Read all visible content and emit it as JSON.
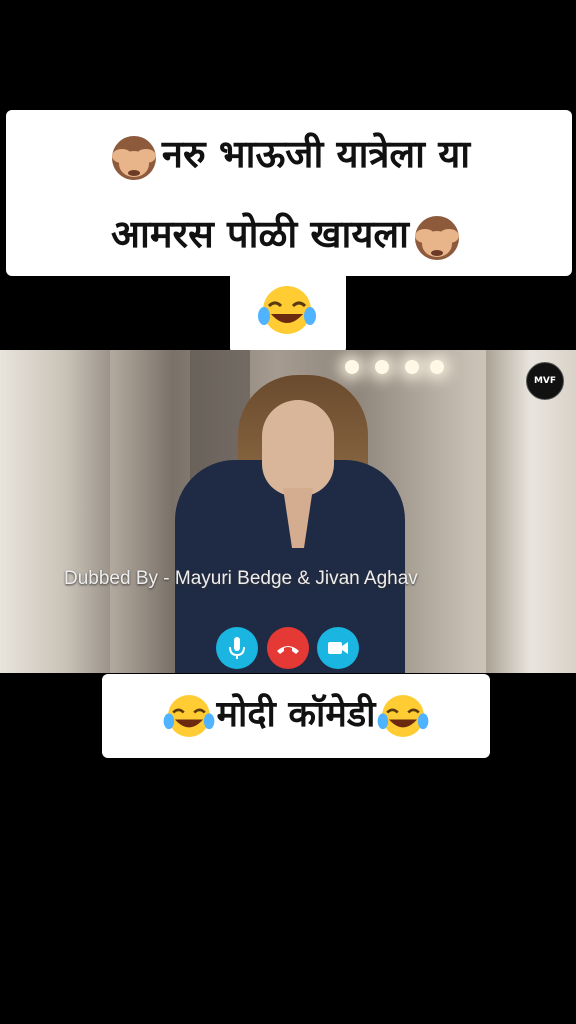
{
  "top_caption": {
    "line1": "नरु भाऊजी यात्रेला या",
    "line2": "आमरस पोळी खायला",
    "emoji_icons": [
      "see-no-evil-monkey",
      "see-no-evil-monkey",
      "laughing-tears-face"
    ]
  },
  "video": {
    "logo_text": "MVF",
    "credit_text": "Dubbed By - Mayuri Bedge & Jivan Aghav",
    "call_buttons": [
      "microphone-icon",
      "end-call-icon",
      "video-camera-icon"
    ]
  },
  "bottom_caption": {
    "text": "मोदी कॉमेडी",
    "emoji_icons": [
      "laughing-tears-face",
      "laughing-tears-face"
    ]
  },
  "colors": {
    "background": "#000000",
    "caption_bg": "#ffffff",
    "call_button_blue": "#1ab5e0",
    "end_call_red": "#e53935"
  }
}
